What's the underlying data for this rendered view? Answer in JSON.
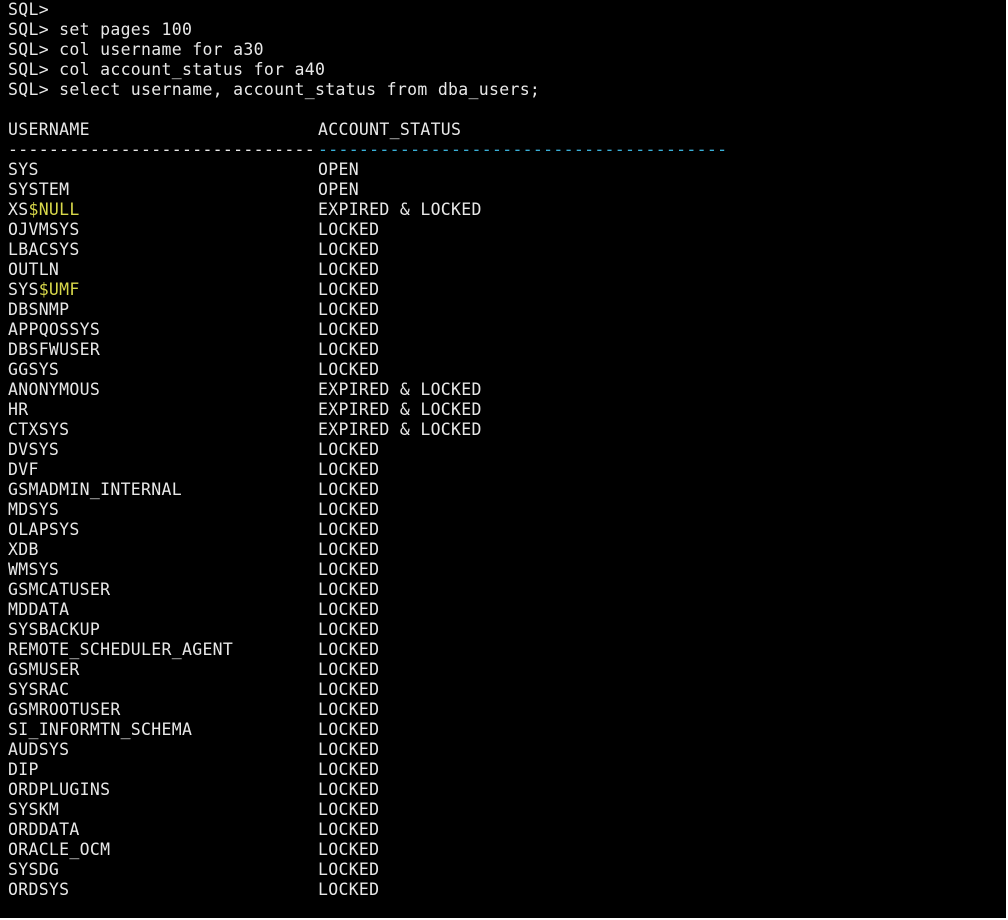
{
  "terminal": {
    "prompt": "SQL>",
    "commands": [
      "",
      "set pages 100",
      "col username for a30",
      "col account_status for a40",
      "select username, account_status from dba_users;"
    ],
    "columns": [
      "USERNAME",
      "ACCOUNT_STATUS"
    ],
    "separators": [
      "------------------------------",
      "----------------------------------------"
    ],
    "rows": [
      {
        "user": "SYS",
        "status": "OPEN"
      },
      {
        "user": "SYSTEM",
        "status": "OPEN"
      },
      {
        "user": "XS$NULL",
        "status": "EXPIRED & LOCKED"
      },
      {
        "user": "OJVMSYS",
        "status": "LOCKED"
      },
      {
        "user": "LBACSYS",
        "status": "LOCKED"
      },
      {
        "user": "OUTLN",
        "status": "LOCKED"
      },
      {
        "user": "SYS$UMF",
        "status": "LOCKED"
      },
      {
        "user": "DBSNMP",
        "status": "LOCKED"
      },
      {
        "user": "APPQOSSYS",
        "status": "LOCKED"
      },
      {
        "user": "DBSFWUSER",
        "status": "LOCKED"
      },
      {
        "user": "GGSYS",
        "status": "LOCKED"
      },
      {
        "user": "ANONYMOUS",
        "status": "EXPIRED & LOCKED"
      },
      {
        "user": "HR",
        "status": "EXPIRED & LOCKED"
      },
      {
        "user": "CTXSYS",
        "status": "EXPIRED & LOCKED"
      },
      {
        "user": "DVSYS",
        "status": "LOCKED"
      },
      {
        "user": "DVF",
        "status": "LOCKED"
      },
      {
        "user": "GSMADMIN_INTERNAL",
        "status": "LOCKED"
      },
      {
        "user": "MDSYS",
        "status": "LOCKED"
      },
      {
        "user": "OLAPSYS",
        "status": "LOCKED"
      },
      {
        "user": "XDB",
        "status": "LOCKED"
      },
      {
        "user": "WMSYS",
        "status": "LOCKED"
      },
      {
        "user": "GSMCATUSER",
        "status": "LOCKED"
      },
      {
        "user": "MDDATA",
        "status": "LOCKED"
      },
      {
        "user": "SYSBACKUP",
        "status": "LOCKED"
      },
      {
        "user": "REMOTE_SCHEDULER_AGENT",
        "status": "LOCKED"
      },
      {
        "user": "GSMUSER",
        "status": "LOCKED"
      },
      {
        "user": "SYSRAC",
        "status": "LOCKED"
      },
      {
        "user": "GSMROOTUSER",
        "status": "LOCKED"
      },
      {
        "user": "SI_INFORMTN_SCHEMA",
        "status": "LOCKED"
      },
      {
        "user": "AUDSYS",
        "status": "LOCKED"
      },
      {
        "user": "DIP",
        "status": "LOCKED"
      },
      {
        "user": "ORDPLUGINS",
        "status": "LOCKED"
      },
      {
        "user": "SYSKM",
        "status": "LOCKED"
      },
      {
        "user": "ORDDATA",
        "status": "LOCKED"
      },
      {
        "user": "ORACLE_OCM",
        "status": "LOCKED"
      },
      {
        "user": "SYSDG",
        "status": "LOCKED"
      },
      {
        "user": "ORDSYS",
        "status": "LOCKED"
      }
    ]
  },
  "colors": {
    "background": "#000000",
    "text": "#e8e8e8",
    "highlight": "#d8d84a",
    "dash_cyan": "#3ab0d8"
  }
}
